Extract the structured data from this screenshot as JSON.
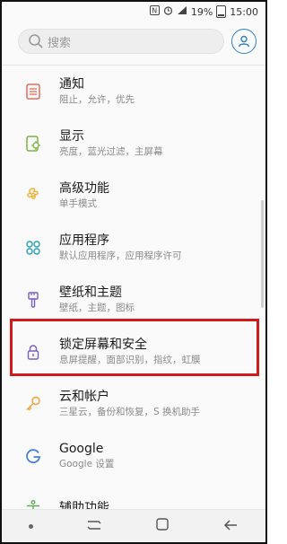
{
  "status_bar": {
    "battery": "19%",
    "time": "15:00"
  },
  "search": {
    "placeholder": "搜索"
  },
  "settings_items": [
    {
      "title": "通知",
      "subtitle": "阻止，允许，优先",
      "icon": "notification-icon",
      "color": "#e86a5a"
    },
    {
      "title": "显示",
      "subtitle": "亮度，蓝光过滤，主屏幕",
      "icon": "display-icon",
      "color": "#7cb342"
    },
    {
      "title": "高级功能",
      "subtitle": "单手模式",
      "icon": "advanced-features-icon",
      "color": "#f2b233"
    },
    {
      "title": "应用程序",
      "subtitle": "默认应用程序，应用程序许可",
      "icon": "apps-icon",
      "color": "#26a0b5"
    },
    {
      "title": "壁纸和主题",
      "subtitle": "壁纸，主题，图标",
      "icon": "brush-icon",
      "color": "#7b5ec2"
    },
    {
      "title": "锁定屏幕和安全",
      "subtitle": "息屏提醒，面部识别，指纹，虹膜",
      "icon": "lock-icon",
      "color": "#7b5ec2"
    },
    {
      "title": "云和帐户",
      "subtitle": "三星云，备份和恢复，S 换机助手",
      "icon": "key-icon",
      "color": "#f0a030"
    },
    {
      "title": "Google",
      "subtitle": "Google 设置",
      "icon": "google-icon",
      "color": "#4a7fd6"
    },
    {
      "title": "辅助功能",
      "subtitle": "",
      "icon": "accessibility-icon",
      "color": "#5cae52"
    }
  ],
  "colors": {
    "highlight": "#d11a1a",
    "accent": "#2f7fc8"
  }
}
